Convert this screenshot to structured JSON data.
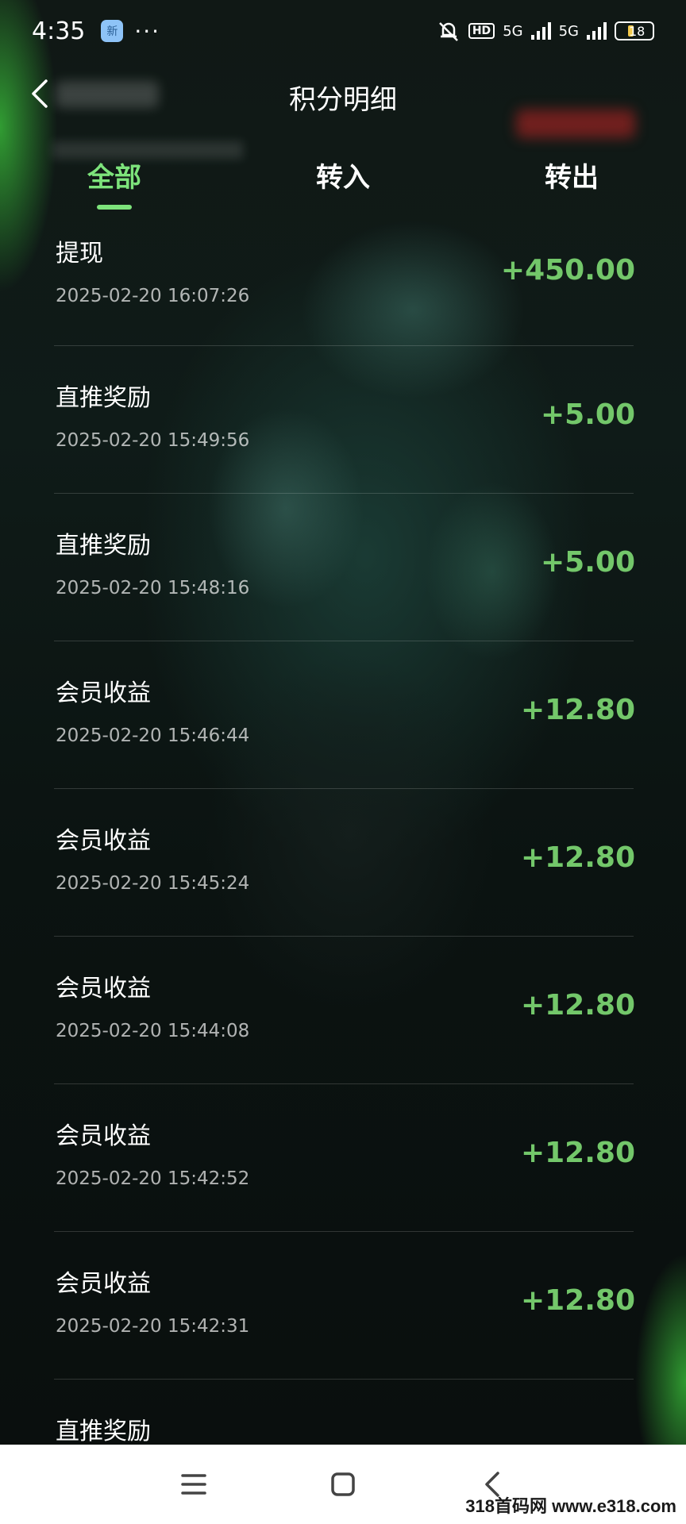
{
  "status_bar": {
    "time": "4:35",
    "app_badge": "新",
    "more": "···",
    "hd": "HD",
    "net1": "5G",
    "net2": "5G",
    "battery": "18"
  },
  "header": {
    "title": "积分明细"
  },
  "tabs": [
    {
      "label": "全部",
      "active": true
    },
    {
      "label": "转入",
      "active": false
    },
    {
      "label": "转出",
      "active": false
    }
  ],
  "records": [
    {
      "title": "提现",
      "time": "2025-02-20 16:07:26",
      "amount": "+450.00"
    },
    {
      "title": "直推奖励",
      "time": "2025-02-20 15:49:56",
      "amount": "+5.00"
    },
    {
      "title": "直推奖励",
      "time": "2025-02-20 15:48:16",
      "amount": "+5.00"
    },
    {
      "title": "会员收益",
      "time": "2025-02-20 15:46:44",
      "amount": "+12.80"
    },
    {
      "title": "会员收益",
      "time": "2025-02-20 15:45:24",
      "amount": "+12.80"
    },
    {
      "title": "会员收益",
      "time": "2025-02-20 15:44:08",
      "amount": "+12.80"
    },
    {
      "title": "会员收益",
      "time": "2025-02-20 15:42:52",
      "amount": "+12.80"
    },
    {
      "title": "会员收益",
      "time": "2025-02-20 15:42:31",
      "amount": "+12.80"
    },
    {
      "title": "直推奖励",
      "time": "",
      "amount": ""
    }
  ],
  "watermark": "318首码网 www.e318.com",
  "colors": {
    "accent": "#7de37b",
    "amount": "#73c76a"
  }
}
